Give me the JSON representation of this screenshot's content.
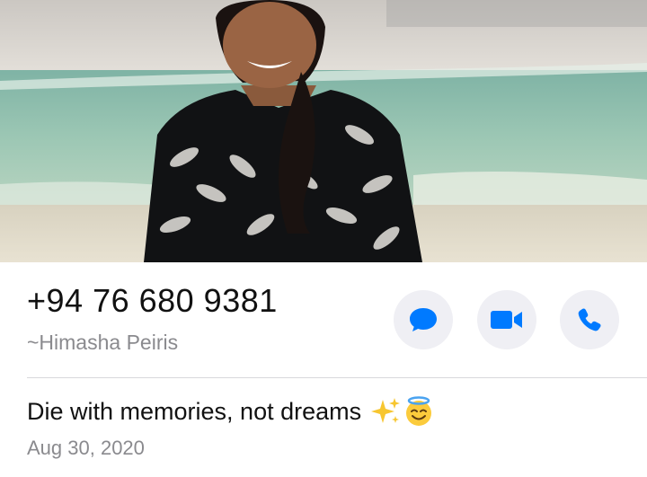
{
  "contact": {
    "phone_number": "+94 76 680 9381",
    "push_name": "~Himasha Peiris"
  },
  "actions": [
    {
      "name": "message",
      "icon": "chat-bubble-icon"
    },
    {
      "name": "video",
      "icon": "video-camera-icon"
    },
    {
      "name": "audio",
      "icon": "phone-icon"
    }
  ],
  "about": {
    "text": "Die with memories, not dreams",
    "emojis": [
      "sparkles-icon",
      "smiling-face-with-halo-icon"
    ],
    "date": "Aug 30, 2020"
  },
  "colors": {
    "accent": "#007aff",
    "button_bg": "#efeff4",
    "secondary_text": "#8a8a8e"
  }
}
